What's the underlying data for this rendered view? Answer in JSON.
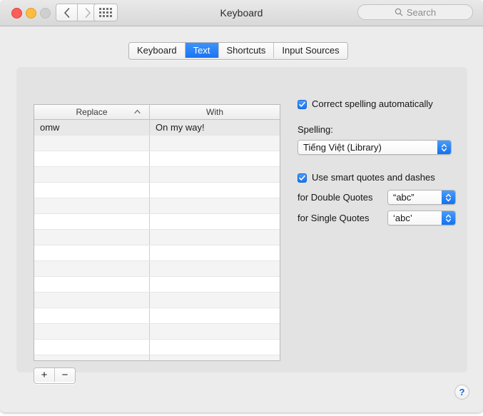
{
  "window": {
    "title": "Keyboard",
    "traffic_lights": [
      "close",
      "minimize",
      "zoom-disabled"
    ]
  },
  "toolbar": {
    "back_icon": "chevron-left-icon",
    "forward_icon": "chevron-right-icon",
    "show_all_icon": "grid-dots-icon",
    "search": {
      "placeholder": "Search",
      "value": "",
      "icon": "search-icon"
    }
  },
  "tabs": [
    {
      "label": "Keyboard",
      "active": false
    },
    {
      "label": "Text",
      "active": true
    },
    {
      "label": "Shortcuts",
      "active": false
    },
    {
      "label": "Input Sources",
      "active": false
    }
  ],
  "table": {
    "columns": [
      {
        "label": "Replace",
        "sort": "ascending",
        "sort_icon": "chevron-up-icon"
      },
      {
        "label": "With",
        "sort": "none"
      }
    ],
    "rows": [
      {
        "replace": "omw",
        "with": "On my way!"
      }
    ],
    "empty_row_count": 15
  },
  "table_actions": {
    "add_label": "+",
    "remove_label": "−",
    "add_icon": "plus-icon",
    "remove_icon": "minus-icon"
  },
  "options": {
    "correct_spelling": {
      "label": "Correct spelling automatically",
      "checked": true
    },
    "spelling": {
      "label": "Spelling:",
      "value": "Tiếng Việt (Library)"
    },
    "smart_quotes": {
      "label": "Use smart quotes and dashes",
      "checked": true
    },
    "double_quotes": {
      "label": "for Double Quotes",
      "value": "“abc”"
    },
    "single_quotes": {
      "label": "for Single Quotes",
      "value": "‘abc’"
    }
  },
  "help": {
    "label": "?"
  },
  "colors": {
    "accent_blue": "#1a74f2",
    "window_bg": "#ececec",
    "panel_bg": "#e3e3e3",
    "help_blue": "#1b63d6"
  }
}
